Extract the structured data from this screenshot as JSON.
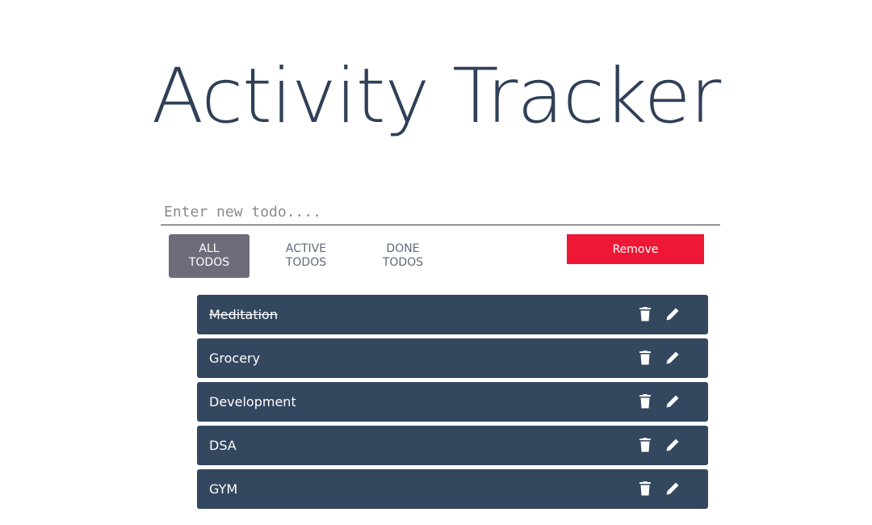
{
  "header": {
    "title": "Activity Tracker"
  },
  "new_todo": {
    "placeholder": "Enter new todo....",
    "value": ""
  },
  "filters": [
    {
      "label": "ALL\nTODOS",
      "selected": true
    },
    {
      "label": "ACTIVE\nTODOS",
      "selected": false
    },
    {
      "label": "DONE\nTODOS",
      "selected": false
    }
  ],
  "remove_button": {
    "label": "Remove"
  },
  "todos": [
    {
      "label": "Meditation",
      "done": true
    },
    {
      "label": "Grocery",
      "done": false
    },
    {
      "label": "Development",
      "done": false
    },
    {
      "label": "DSA",
      "done": false
    },
    {
      "label": "GYM",
      "done": false
    }
  ],
  "icons": {
    "delete": "trash-icon",
    "edit": "pencil-icon"
  },
  "colors": {
    "title": "#2f4057",
    "todo_background": "#33475f",
    "remove_button": "#ee1736",
    "selected_filter": "#6f6b7b"
  }
}
